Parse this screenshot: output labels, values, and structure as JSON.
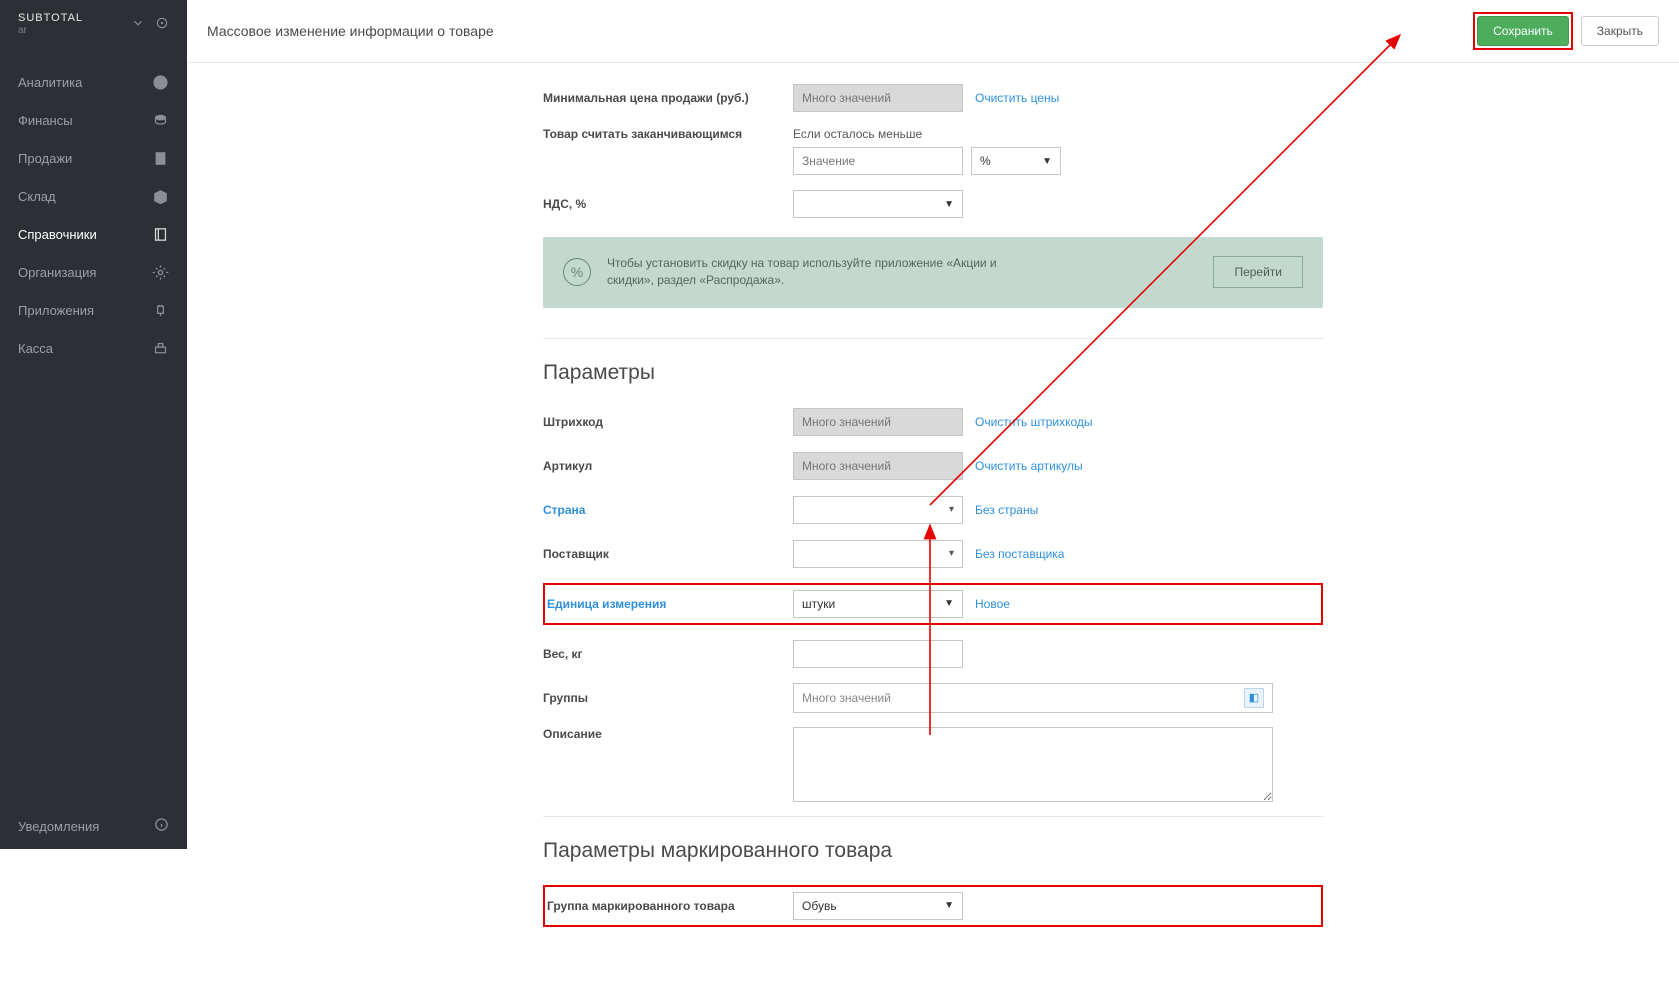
{
  "brand": {
    "name": "SUBTOTAL",
    "sub": "ar"
  },
  "sidebar": {
    "items": [
      {
        "label": "Аналитика"
      },
      {
        "label": "Финансы"
      },
      {
        "label": "Продажи"
      },
      {
        "label": "Склад"
      },
      {
        "label": "Справочники"
      },
      {
        "label": "Организация"
      },
      {
        "label": "Приложения"
      },
      {
        "label": "Касса"
      }
    ],
    "footer": "Уведомления"
  },
  "header": {
    "title": "Массовое изменение информации о товаре",
    "save": "Сохранить",
    "close": "Закрыть"
  },
  "pricing": {
    "min_price_label": "Минимальная цена продажи (руб.)",
    "min_price_placeholder": "Много значений",
    "clear_prices": "Очистить цены",
    "ending_label": "Товар считать заканчивающимся",
    "ending_hint": "Если осталось меньше",
    "ending_value_placeholder": "Значение",
    "ending_unit": "%",
    "vat_label": "НДС, %"
  },
  "infobox": {
    "text": "Чтобы установить скидку на товар используйте приложение «Акции и скидки», раздел «Распродажа».",
    "goto": "Перейти"
  },
  "params": {
    "heading": "Параметры",
    "barcode_label": "Штрихкод",
    "barcode_placeholder": "Много значений",
    "clear_barcodes": "Очистить штрихкоды",
    "sku_label": "Артикул",
    "sku_placeholder": "Много значений",
    "clear_skus": "Очистить артикулы",
    "country_label": "Страна",
    "no_country": "Без страны",
    "supplier_label": "Поставщик",
    "no_supplier": "Без поставщика",
    "unit_label": "Единица измерения",
    "unit_value": "штуки",
    "unit_new": "Новое",
    "weight_label": "Вес, кг",
    "groups_label": "Группы",
    "groups_placeholder": "Много значений",
    "description_label": "Описание"
  },
  "marked": {
    "heading": "Параметры маркированного товара",
    "group_label": "Группа маркированного товара",
    "group_value": "Обувь"
  }
}
